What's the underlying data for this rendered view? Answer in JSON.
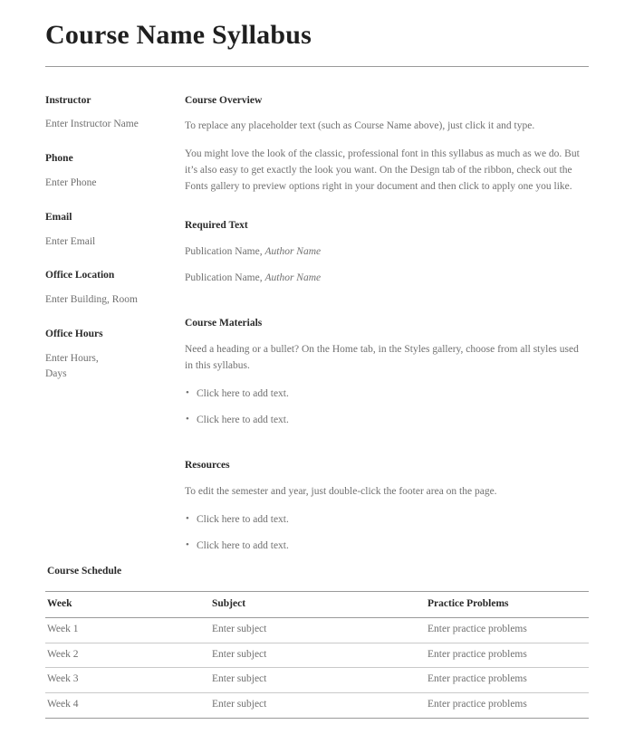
{
  "document": {
    "title": "Course Name Syllabus"
  },
  "sidebar": {
    "blocks": [
      {
        "label": "Instructor",
        "value": "Enter Instructor Name"
      },
      {
        "label": "Phone",
        "value": "Enter Phone"
      },
      {
        "label": "Email",
        "value": "Enter Email"
      },
      {
        "label": "Office Location",
        "value": "Enter Building, Room"
      },
      {
        "label": "Office Hours",
        "value": "Enter Hours,\nDays"
      }
    ]
  },
  "main": {
    "course_overview": {
      "heading": "Course Overview",
      "paragraph1": "To replace any placeholder text (such as Course Name above), just click it and type.",
      "paragraph2": "You might love the look of the classic, professional font in this syllabus as much as we do. But it’s also easy to get exactly the look you want. On the Design tab of the ribbon, check out the Fonts gallery to preview options right in your document and then click to apply one you like."
    },
    "required_text": {
      "heading": "Required Text",
      "entries": [
        {
          "publication": "Publication Name,",
          "author": "Author Name"
        },
        {
          "publication": "Publication Name,",
          "author": "Author Name"
        }
      ]
    },
    "course_materials": {
      "heading": "Course Materials",
      "paragraph": "Need a heading or a bullet? On the Home tab, in the Styles gallery, choose from all styles used in this syllabus.",
      "bullets": [
        "Click here to add text.",
        "Click here to add text."
      ]
    },
    "resources": {
      "heading": "Resources",
      "paragraph": "To edit the semester and year, just double-click the footer area on the page.",
      "bullets": [
        "Click here to add text.",
        "Click here to add text."
      ]
    }
  },
  "schedule": {
    "title": "Course Schedule",
    "columns": [
      "Week",
      "Subject",
      "Practice Problems"
    ],
    "rows": [
      [
        "Week 1",
        "Enter subject",
        "Enter practice problems"
      ],
      [
        "Week 2",
        "Enter subject",
        "Enter practice problems"
      ],
      [
        "Week 3",
        "Enter subject",
        "Enter practice problems"
      ],
      [
        "Week 4",
        "Enter subject",
        "Enter practice problems"
      ]
    ]
  },
  "colors": {
    "heading_text": "#2a2a2a",
    "body_text": "#6f6f6f",
    "rule_strong": "#9a9a9a",
    "rule_light": "#c9c9c9",
    "page_background": "#ffffff"
  }
}
